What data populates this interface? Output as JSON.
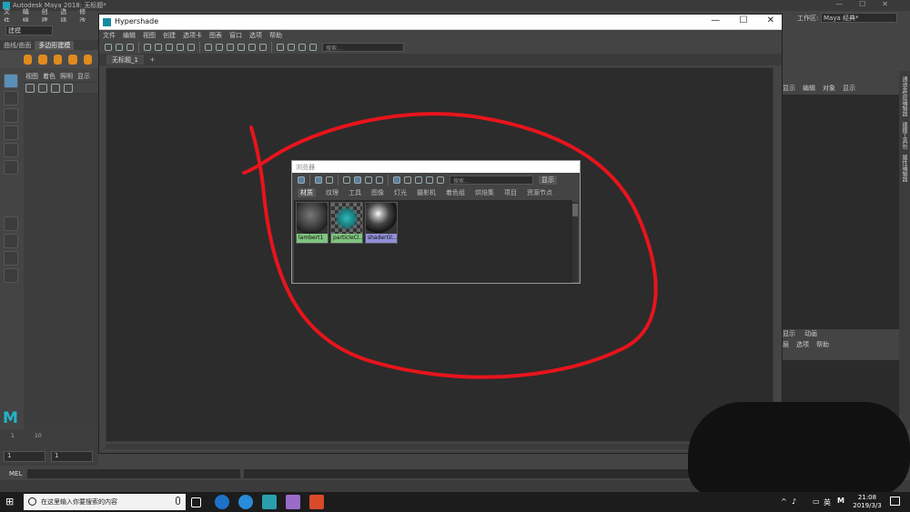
{
  "maya": {
    "window_title": "Autodesk Maya 2018: 无标题*",
    "menu": [
      "文件",
      "编辑",
      "创建",
      "选择",
      "修改"
    ],
    "workspace_label": "工作区:",
    "workspace_value": "Maya 经典*",
    "mode_value": "建模",
    "shelf_tabs": [
      "曲线/曲面",
      "多边形建模"
    ],
    "left_viewport_menu": [
      "视图",
      "着色",
      "照明",
      "显示"
    ],
    "right_panel_menu": [
      "显示",
      "编辑",
      "对象",
      "显示"
    ],
    "right_tabs2": [
      "显示",
      "动画"
    ],
    "right_menu2": [
      "层",
      "选项",
      "帮助"
    ],
    "right_vtabs": [
      "通道盒/层编辑器",
      "建模工具包",
      "属性编辑器"
    ],
    "timeline_start_a": "1",
    "timeline_start_b": "1",
    "timeline_tick_1": "1",
    "timeline_tick_10": "10",
    "mel_label": "MEL"
  },
  "hypershade": {
    "title": "Hypershade",
    "menu": [
      "文件",
      "编辑",
      "视图",
      "创建",
      "选项卡",
      "图表",
      "窗口",
      "选项",
      "帮助"
    ],
    "search_placeholder": "搜索...",
    "tab_label": "无标题_1",
    "tab_add": "+",
    "win_minimize": "—",
    "win_maximize": "☐",
    "win_close": "✕"
  },
  "browser": {
    "title": "浏览器",
    "search_placeholder": "搜索...",
    "show_button": "显示",
    "tabs": [
      "材质",
      "纹理",
      "工具",
      "图像",
      "灯光",
      "摄影机",
      "着色组",
      "烘焙集",
      "项目",
      "资源节点"
    ],
    "swatches": [
      {
        "label": "lambert1",
        "label_color": "#7fc47f"
      },
      {
        "label": "particleCl...",
        "label_color": "#7fc47f"
      },
      {
        "label": "shaderGl...",
        "label_color": "#8f8fd8"
      }
    ]
  },
  "taskbar": {
    "search_text": "在这里输入你要搜索的内容",
    "lang": "英",
    "ime": "M",
    "time": "21:08",
    "date": "2019/3/3"
  },
  "colors": {
    "annotation_red": "#e8141c",
    "maya_teal": "#23b4c8"
  }
}
